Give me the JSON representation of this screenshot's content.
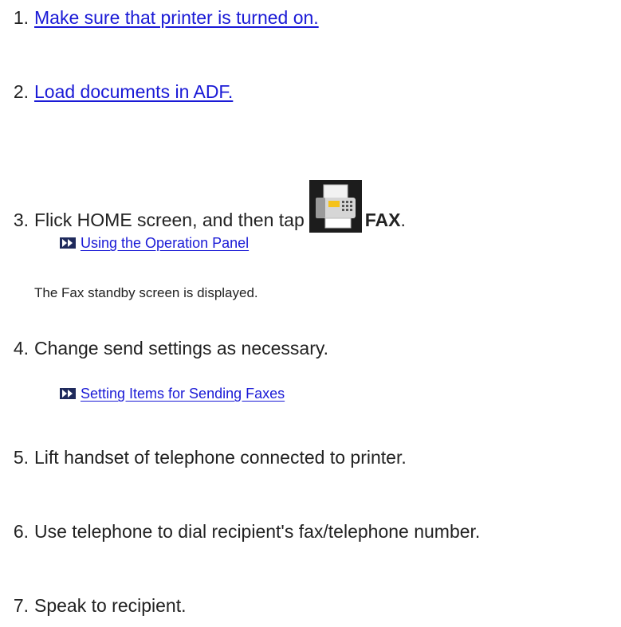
{
  "steps": [
    {
      "number": "1.",
      "text": "Make sure that printer is turned on."
    },
    {
      "number": "2.",
      "text": "Load documents in ADF."
    },
    {
      "number": "3.",
      "text_before": "Flick HOME screen, and then tap",
      "icon": "fax-icon",
      "bold": "FAX",
      "after": "."
    },
    {
      "number": "4.",
      "text": "Change send settings as necessary."
    },
    {
      "number": "5.",
      "text": "Lift handset of telephone connected to printer."
    },
    {
      "number": "6.",
      "text": "Use telephone to dial recipient's fax/telephone number."
    },
    {
      "number": "7.",
      "text": "Speak to recipient."
    }
  ],
  "links": {
    "operation_panel": "Using the Operation Panel",
    "setting_items": "Setting Items for Sending Faxes"
  },
  "notes": {
    "fax_standby": "The Fax standby screen is displayed."
  },
  "colors": {
    "link": "#1a1ad6",
    "text": "#222222",
    "icon_arrow": "#1f2a5c"
  }
}
